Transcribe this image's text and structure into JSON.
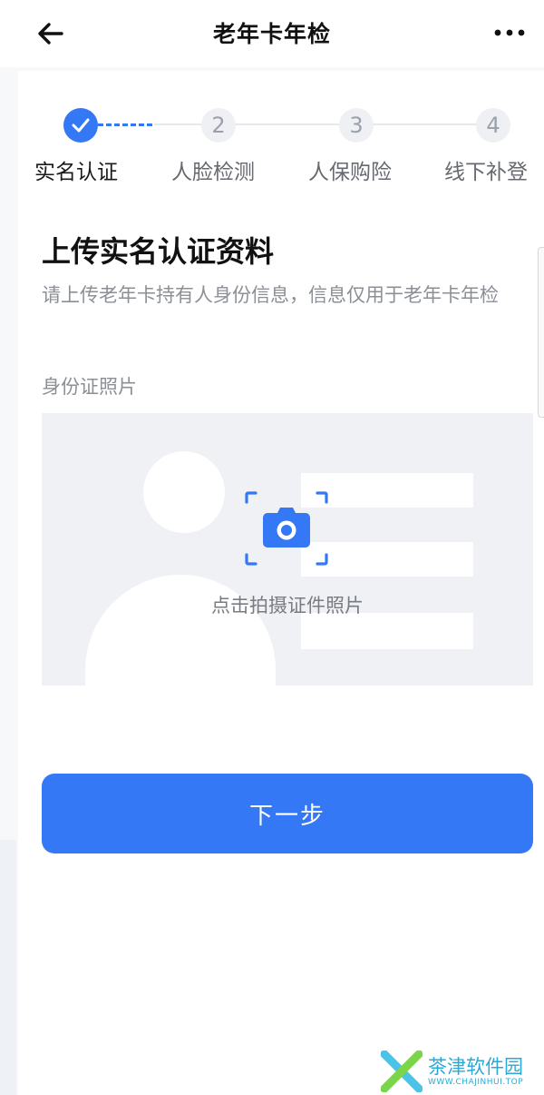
{
  "header": {
    "title": "老年卡年检",
    "back_icon": "arrow-left-icon",
    "more_icon": "more-dots-icon"
  },
  "steps": [
    {
      "number": "",
      "label": "实名认证",
      "state": "done",
      "icon": "check-icon"
    },
    {
      "number": "2",
      "label": "人脸检测",
      "state": "pending"
    },
    {
      "number": "3",
      "label": "人保购险",
      "state": "pending"
    },
    {
      "number": "4",
      "label": "线下补登",
      "state": "pending"
    }
  ],
  "main": {
    "title": "上传实名认证资料",
    "description": "请上传老年卡持有人身份信息，信息仅用于老年卡年检",
    "id_label": "身份证照片",
    "upload_hint": "点击拍摄证件照片",
    "camera_icon": "camera-icon"
  },
  "next_button": {
    "label": "下一步"
  },
  "watermark": {
    "cn": "茶津软件园",
    "en": "WWW.CHAJINHUI.TOP"
  },
  "colors": {
    "accent": "#3478f6",
    "muted_text": "#8b8f96",
    "upload_bg": "#f0f1f4"
  }
}
